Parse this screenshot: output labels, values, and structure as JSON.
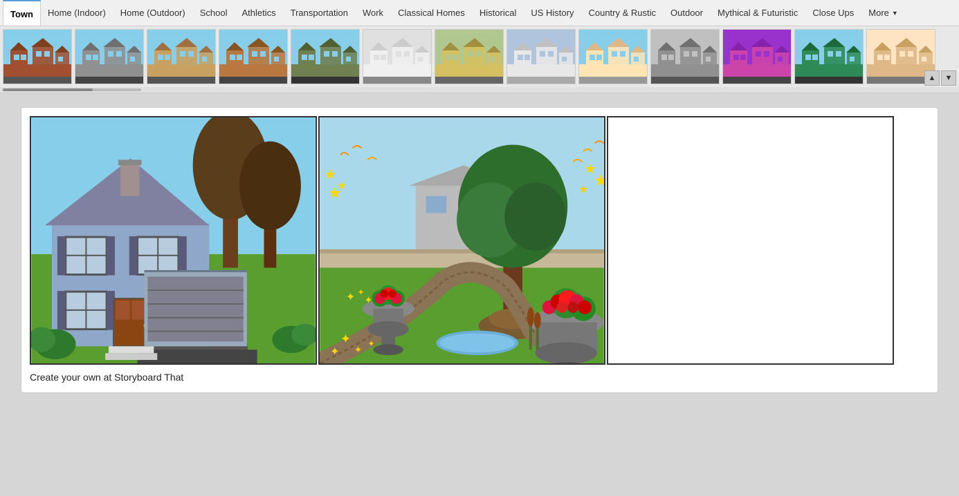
{
  "navbar": {
    "tabs": [
      {
        "id": "town",
        "label": "Town",
        "active": true
      },
      {
        "id": "home-indoor",
        "label": "Home (Indoor)",
        "active": false
      },
      {
        "id": "home-outdoor",
        "label": "Home (Outdoor)",
        "active": false
      },
      {
        "id": "school",
        "label": "School",
        "active": false
      },
      {
        "id": "athletics",
        "label": "Athletics",
        "active": false
      },
      {
        "id": "transportation",
        "label": "Transportation",
        "active": false
      },
      {
        "id": "work",
        "label": "Work",
        "active": false
      },
      {
        "id": "classical-homes",
        "label": "Classical Homes",
        "active": false
      },
      {
        "id": "historical",
        "label": "Historical",
        "active": false
      },
      {
        "id": "us-history",
        "label": "US History",
        "active": false
      },
      {
        "id": "country-rustic",
        "label": "Country & Rustic",
        "active": false
      },
      {
        "id": "outdoor",
        "label": "Outdoor",
        "active": false
      },
      {
        "id": "mythical-futuristic",
        "label": "Mythical & Futuristic",
        "active": false
      },
      {
        "id": "close-ups",
        "label": "Close Ups",
        "active": false
      },
      {
        "id": "more",
        "label": "More",
        "active": false,
        "hasDropdown": true
      }
    ]
  },
  "thumbnails": [
    {
      "id": "thumb-1",
      "class": "thumb-town1",
      "alt": "Town scene 1"
    },
    {
      "id": "thumb-2",
      "class": "thumb-town2",
      "alt": "Town scene 2"
    },
    {
      "id": "thumb-3",
      "class": "thumb-town3",
      "alt": "Town scene 3"
    },
    {
      "id": "thumb-4",
      "class": "thumb-town4",
      "alt": "Town scene 4"
    },
    {
      "id": "thumb-5",
      "class": "thumb-town5",
      "alt": "Town scene 5"
    },
    {
      "id": "thumb-6",
      "class": "thumb-town6",
      "alt": "Town scene 6"
    },
    {
      "id": "thumb-7",
      "class": "thumb-town7",
      "alt": "Town scene 7"
    },
    {
      "id": "thumb-8",
      "class": "thumb-town8",
      "alt": "Town scene 8"
    },
    {
      "id": "thumb-9",
      "class": "thumb-town9",
      "alt": "Town scene 9"
    },
    {
      "id": "thumb-10",
      "class": "thumb-town10",
      "alt": "Town scene 10"
    },
    {
      "id": "thumb-11",
      "class": "thumb-town11",
      "alt": "Town scene 11"
    },
    {
      "id": "thumb-12",
      "class": "thumb-town12",
      "alt": "Town scene 12"
    },
    {
      "id": "thumb-13",
      "class": "thumb-town13",
      "alt": "Town scene 13"
    }
  ],
  "arrow_up_label": "▲",
  "arrow_down_label": "▼",
  "panels": [
    {
      "id": "panel-1",
      "type": "house",
      "empty": false
    },
    {
      "id": "panel-2",
      "type": "garden",
      "empty": false
    },
    {
      "id": "panel-3",
      "type": "empty",
      "empty": true
    }
  ],
  "caption": "Create your own at Storyboard That"
}
